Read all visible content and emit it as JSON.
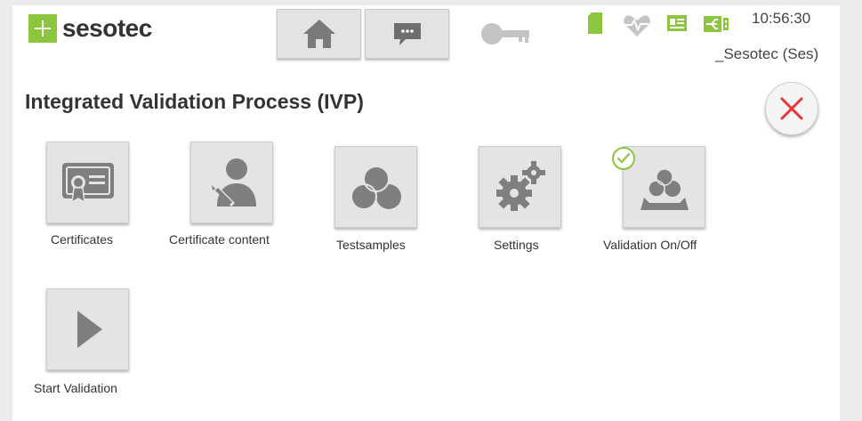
{
  "brand": {
    "name": "sesotec"
  },
  "header": {
    "nav_buttons": [
      {
        "name": "home",
        "icon": "home-icon"
      },
      {
        "name": "messages",
        "icon": "chat-bubble-icon"
      }
    ],
    "key_icon": "key-icon",
    "status_icons": [
      "sd-card-icon",
      "heart-pulse-icon",
      "monitor-icon",
      "usb-icon"
    ],
    "time": "10:56:30",
    "user": "_Sesotec (Ses)"
  },
  "page": {
    "title": "Integrated Validation Process (IVP)"
  },
  "tiles": [
    {
      "label": "Certificates",
      "icon": "certificate-icon"
    },
    {
      "label": "Certificate content",
      "icon": "user-edit-icon"
    },
    {
      "label": "Testsamples",
      "icon": "test-samples-icon"
    },
    {
      "label": "Settings",
      "icon": "gears-icon"
    },
    {
      "label": "Validation On/Off",
      "icon": "validation-toggle-icon",
      "status": "on"
    },
    {
      "label": "Start Validation",
      "icon": "play-icon"
    }
  ],
  "colors": {
    "brand_green": "#8cc63f",
    "close_red": "#e53935",
    "icon_gray": "#808080"
  }
}
